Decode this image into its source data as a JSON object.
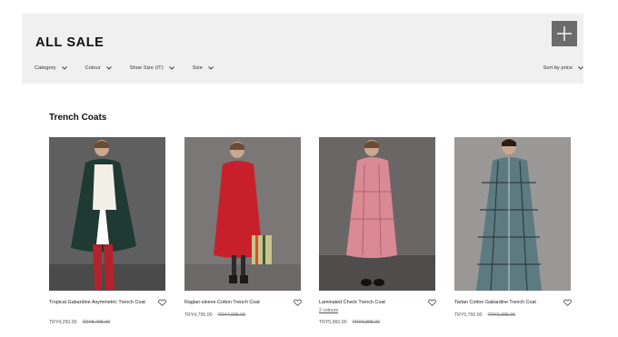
{
  "header": {
    "title": "ALL SALE",
    "filters": [
      {
        "label": "Category"
      },
      {
        "label": "Colour"
      },
      {
        "label": "Shoe Size (IT)"
      },
      {
        "label": "Size"
      }
    ],
    "sort_label": "Sort by price",
    "plus_icon": "plus-icon"
  },
  "section": {
    "title": "Trench Coats"
  },
  "products": [
    {
      "name": "Tropical Gabardine Asymmetric Trench Coat",
      "colours": "",
      "price": "TRY4,250.00",
      "old_price": "TRY8,495.00",
      "bg": "#5f5f60",
      "coat": "#1f3a32"
    },
    {
      "name": "Raglan-sleeve Cotton Trench Coat",
      "colours": "",
      "price": "TRY4,795.00",
      "old_price": "TRY7,995.00",
      "bg": "#7a7776",
      "coat": "#c8202a"
    },
    {
      "name": "Laminated Check Trench Coat",
      "colours": "2 colours",
      "price": "TRY5,960.00",
      "old_price": "TRY9,895.00",
      "bg": "#6a6665",
      "coat": "#d98a95"
    },
    {
      "name": "Tartan Cotton Gabardine Trench Coat",
      "colours": "",
      "price": "TRY5,760.00",
      "old_price": "TRY9,395.00",
      "bg": "#9a9797",
      "coat": "#5d7a80"
    }
  ]
}
